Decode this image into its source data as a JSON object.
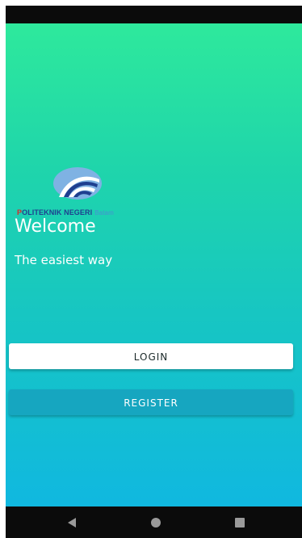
{
  "colors": {
    "gradient_top": "#2ee99c",
    "gradient_bottom": "#10b8e0",
    "login_bg": "#ffffff",
    "register_bg": "#16a6c0"
  },
  "logo": {
    "emblem_icon": "polytechnic-emblem-icon",
    "text_initial": "P",
    "text_main": "OLITEKNIK NEGERI",
    "text_sub": "Batam"
  },
  "welcome": {
    "title": "Welcome",
    "subtitle": "The easiest way"
  },
  "buttons": {
    "login_label": "LOGIN",
    "register_label": "REGISTER"
  },
  "nav": {
    "back_icon": "back-triangle-icon",
    "home_icon": "home-circle-icon",
    "recent_icon": "recent-apps-square-icon"
  }
}
